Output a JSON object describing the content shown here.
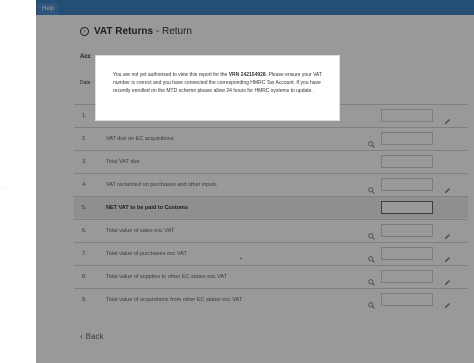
{
  "topbar": {
    "help_label": "Help"
  },
  "page": {
    "title_main": "VAT Returns",
    "title_sep": " - ",
    "title_sub": "Return",
    "account_label": "Acc",
    "date_label": "Date",
    "back_label": "Back"
  },
  "rows": [
    {
      "num": "1.",
      "label": "",
      "search": false,
      "edit": true,
      "highlight": false
    },
    {
      "num": "2.",
      "label": "VAT due on EC acquisitions",
      "search": true,
      "edit": false,
      "highlight": false
    },
    {
      "num": "3.",
      "label": "Total VAT due",
      "search": false,
      "edit": false,
      "highlight": false
    },
    {
      "num": "4.",
      "label": "VAT reclaimed on purchases and other inputs",
      "search": true,
      "edit": true,
      "highlight": false
    },
    {
      "num": "5.",
      "label": "NET VAT to be paid to Customs",
      "search": false,
      "edit": false,
      "highlight": true
    },
    {
      "num": "6.",
      "label": "Total value of sales exc VAT",
      "search": true,
      "edit": true,
      "highlight": false
    },
    {
      "num": "7.",
      "label": "Total value of purchases exc VAT",
      "search": true,
      "edit": true,
      "highlight": false
    },
    {
      "num": "8.",
      "label": "Total value of supplies to other EC states exc VAT",
      "search": true,
      "edit": true,
      "highlight": false
    },
    {
      "num": "9.",
      "label": "Total value of acquisitions from other EC states exc VAT",
      "search": true,
      "edit": true,
      "highlight": false
    }
  ],
  "modal": {
    "text_before": "You are not yet authorised to view this report for the ",
    "vrn": "VRN 242154928",
    "text_after": ". Please ensure your VAT number is correct and you have connected the corresponding HMRC Tax Account. If you have recently enrolled on the MTD scheme please allow 24 hours for HMRC systems to update."
  },
  "colors": {
    "topbar": "#3f83c4",
    "overlay": "rgba(0,0,0,0.40)"
  }
}
